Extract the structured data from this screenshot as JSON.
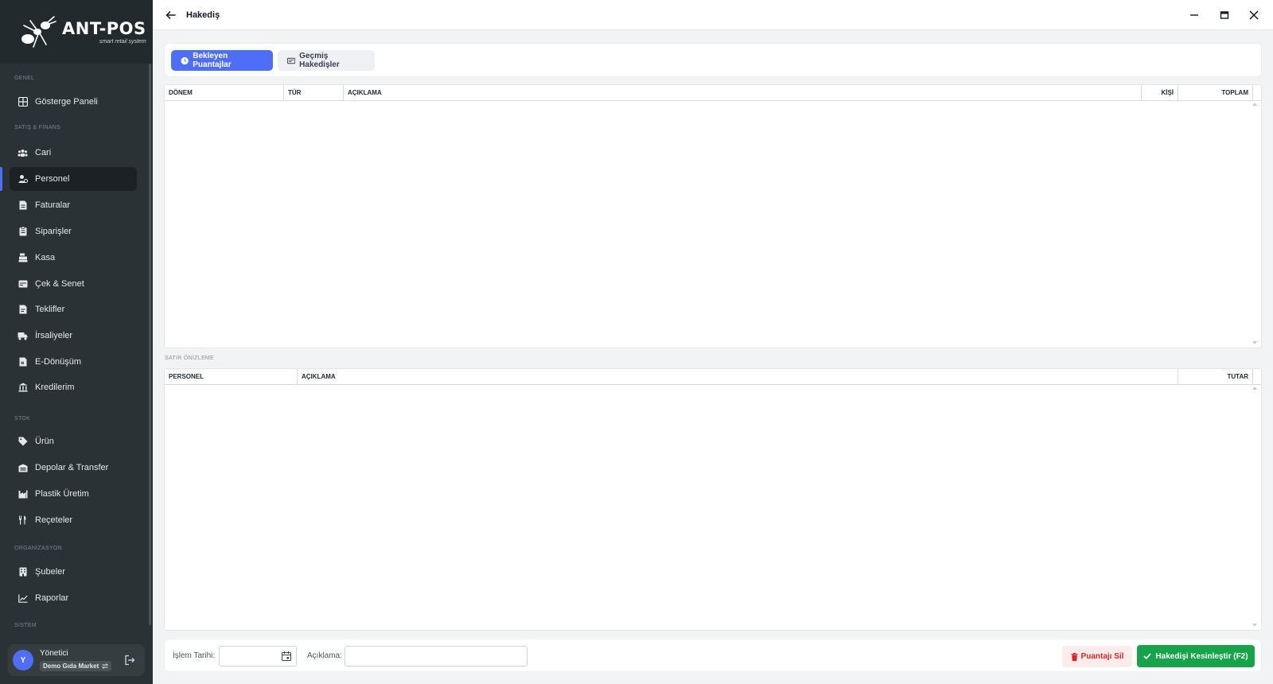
{
  "app": {
    "logo_title": "ANT-POS",
    "logo_subtitle": "smart retail system",
    "window_title": "Hakediş"
  },
  "sidebar": {
    "sections": {
      "genel": "GENEL",
      "satis": "SATIŞ & FİNANS",
      "stok": "STOK",
      "organizasyon": "ORGANİZASYON",
      "sistem": "SİSTEM"
    },
    "items": [
      {
        "label": "Gösterge Paneli",
        "icon": "dashboard-icon"
      },
      {
        "label": "Cari",
        "icon": "users-icon"
      },
      {
        "label": "Personel",
        "icon": "personnel-icon",
        "active": true
      },
      {
        "label": "Faturalar",
        "icon": "invoice-icon"
      },
      {
        "label": "Siparişler",
        "icon": "orders-icon"
      },
      {
        "label": "Kasa",
        "icon": "cash-register-icon"
      },
      {
        "label": "Çek & Senet",
        "icon": "check-icon"
      },
      {
        "label": "Teklifler",
        "icon": "quote-icon"
      },
      {
        "label": "İrsaliyeler",
        "icon": "truck-icon"
      },
      {
        "label": "E-Dönüşüm",
        "icon": "e-document-icon"
      },
      {
        "label": "Kredilerim",
        "icon": "bank-icon"
      },
      {
        "label": "Ürün",
        "icon": "tag-icon"
      },
      {
        "label": "Depolar & Transfer",
        "icon": "warehouse-icon"
      },
      {
        "label": "Plastik Üretim",
        "icon": "factory-icon"
      },
      {
        "label": "Reçeteler",
        "icon": "utensils-icon"
      },
      {
        "label": "Şubeler",
        "icon": "building-icon"
      },
      {
        "label": "Raporlar",
        "icon": "chart-line-icon"
      }
    ],
    "user": {
      "initial": "Y",
      "name": "Yönetici",
      "company": "Demo Gıda Market"
    }
  },
  "tabs": {
    "pending": "Bekleyen Puantajlar",
    "history": "Geçmiş Hakedişler"
  },
  "grid_top": {
    "columns": [
      "DÖNEM",
      "TÜR",
      "AÇIKLAMA",
      "KİŞİ",
      "TOPLAM"
    ]
  },
  "preview": {
    "label": "SATIR ÖNİZLEME",
    "columns": [
      "PERSONEL",
      "AÇIKLAMA",
      "TUTAR"
    ]
  },
  "footer": {
    "date_label": "İşlem Tarihi:",
    "date_value": "",
    "desc_label": "Açıklama:",
    "desc_value": "",
    "delete_button": "Puantajı Sil",
    "confirm_button": "Hakedişi Kesinleştir (F2)"
  },
  "colors": {
    "accent": "#4f6ef7",
    "sidebar_bg": "#2b3236",
    "success": "#16a34a",
    "danger": "#dc2626"
  }
}
